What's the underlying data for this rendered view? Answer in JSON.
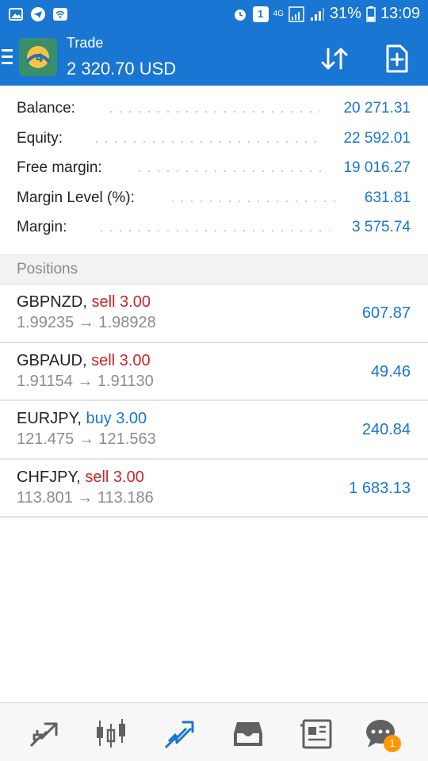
{
  "status_bar": {
    "battery_percent": "31%",
    "time": "13:09",
    "network": "4G",
    "notification_count": "1"
  },
  "header": {
    "title": "Trade",
    "subtitle": "2 320.70 USD"
  },
  "summary": [
    {
      "label": "Balance:",
      "value": "20 271.31"
    },
    {
      "label": "Equity:",
      "value": "22 592.01"
    },
    {
      "label": "Free margin:",
      "value": "19 016.27"
    },
    {
      "label": "Margin Level (%):",
      "value": "631.81"
    },
    {
      "label": "Margin:",
      "value": "3 575.74"
    }
  ],
  "positions_header": "Positions",
  "positions": [
    {
      "symbol": "GBPNZD,",
      "type": "sell 3.00",
      "direction": "sell",
      "prices": "1.99235 → 1.98928",
      "profit": "607.87"
    },
    {
      "symbol": "GBPAUD,",
      "type": "sell 3.00",
      "direction": "sell",
      "prices": "1.91154 → 1.91130",
      "profit": "49.46"
    },
    {
      "symbol": "EURJPY,",
      "type": "buy 3.00",
      "direction": "buy",
      "prices": "121.475 → 121.563",
      "profit": "240.84"
    },
    {
      "symbol": "CHFJPY,",
      "type": "sell 3.00",
      "direction": "sell",
      "prices": "113.801 → 113.186",
      "profit": "1 683.13"
    }
  ],
  "bottom_nav": {
    "items": [
      {
        "icon": "quotes-icon"
      },
      {
        "icon": "chart-icon"
      },
      {
        "icon": "trade-icon",
        "active": true
      },
      {
        "icon": "history-icon"
      },
      {
        "icon": "news-icon"
      },
      {
        "icon": "messages-icon",
        "badge": "1"
      }
    ]
  },
  "colors": {
    "primary": "#1976d2",
    "sell": "#c62828",
    "badge": "#ff9800"
  }
}
